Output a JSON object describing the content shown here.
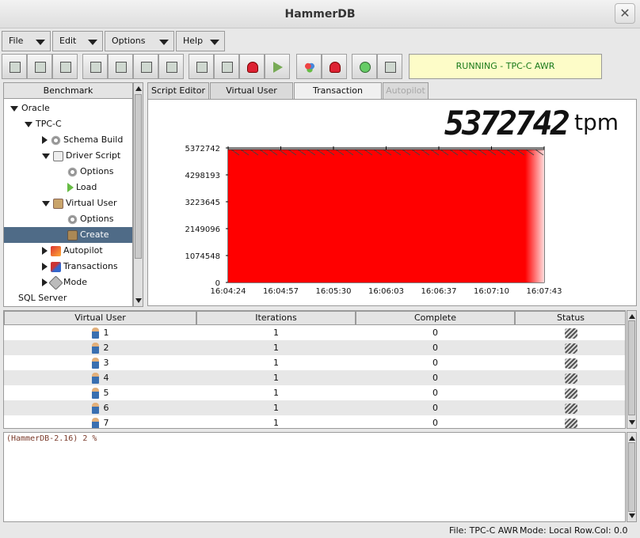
{
  "window": {
    "title": "HammerDB"
  },
  "menus": [
    {
      "label": "File"
    },
    {
      "label": "Edit"
    },
    {
      "label": "Options"
    },
    {
      "label": "Help"
    }
  ],
  "toolbar": {
    "buttons": [
      "new-script-icon",
      "open-icon",
      "save-icon",
      "load-icon",
      "options-icon",
      "copy-icon",
      "search-icon",
      "cursor-icon",
      "monitor-icon",
      "stop-red-icon",
      "run-arrow-icon",
      "users-icon",
      "stop-red-icon",
      "green-run-icon",
      "report-icon"
    ],
    "status": "RUNNING - TPC-C AWR",
    "status_color": "#1a7a1a"
  },
  "tree": {
    "header": "Benchmark",
    "items": [
      {
        "label": "Oracle",
        "expander": "down",
        "icon": ""
      },
      {
        "label": "TPC-C",
        "expander": "down",
        "icon": ""
      },
      {
        "label": "Schema Build",
        "expander": "right",
        "icon": "gear"
      },
      {
        "label": "Driver Script",
        "expander": "down",
        "icon": "doc"
      },
      {
        "label": "Options",
        "expander": "",
        "icon": "gear"
      },
      {
        "label": "Load",
        "expander": "",
        "icon": "play"
      },
      {
        "label": "Virtual User",
        "expander": "down",
        "icon": "users"
      },
      {
        "label": "Options",
        "expander": "",
        "icon": "gear"
      },
      {
        "label": "Create",
        "expander": "",
        "icon": "create"
      },
      {
        "label": "Autopilot",
        "expander": "right",
        "icon": "auto"
      },
      {
        "label": "Transactions",
        "expander": "right",
        "icon": "trans"
      },
      {
        "label": "Mode",
        "expander": "right",
        "icon": "mode"
      },
      {
        "label": "SQL Server",
        "expander": "",
        "icon": ""
      }
    ]
  },
  "tabs": [
    {
      "label": "Script Editor",
      "state": "normal"
    },
    {
      "label": "Virtual User Output",
      "state": "normal"
    },
    {
      "label": "Transaction Counter",
      "state": "active"
    },
    {
      "label": "Autopilot",
      "state": "disabled"
    }
  ],
  "counter": {
    "value": "5372742",
    "unit": "tpm"
  },
  "chart_data": {
    "type": "area",
    "x": [
      "16:04:24",
      "16:04:57",
      "16:05:30",
      "16:06:03",
      "16:06:37",
      "16:07:10",
      "16:07:43"
    ],
    "y_ticks": [
      0,
      1074548,
      2149096,
      3223645,
      4298193,
      5372742
    ],
    "ylim": [
      0,
      5372742
    ],
    "values": [
      5372742,
      5372742,
      5372742,
      5372742,
      5372742,
      5372742,
      5372742
    ],
    "fill_color": "#ff0000",
    "grid": false
  },
  "table": {
    "columns": [
      "Virtual User",
      "Iterations",
      "Complete",
      "Status"
    ],
    "rows": [
      {
        "user": "1",
        "iterations": "1",
        "complete": "0"
      },
      {
        "user": "2",
        "iterations": "1",
        "complete": "0"
      },
      {
        "user": "3",
        "iterations": "1",
        "complete": "0"
      },
      {
        "user": "4",
        "iterations": "1",
        "complete": "0"
      },
      {
        "user": "5",
        "iterations": "1",
        "complete": "0"
      },
      {
        "user": "6",
        "iterations": "1",
        "complete": "0"
      },
      {
        "user": "7",
        "iterations": "1",
        "complete": "0"
      }
    ]
  },
  "console": {
    "prompt": "(HammerDB-2.16) 2 %"
  },
  "statusbar": {
    "file": "File: TPC-C AWR",
    "mode": "Mode: Local",
    "rowcol": "Row.Col:  0.0"
  }
}
